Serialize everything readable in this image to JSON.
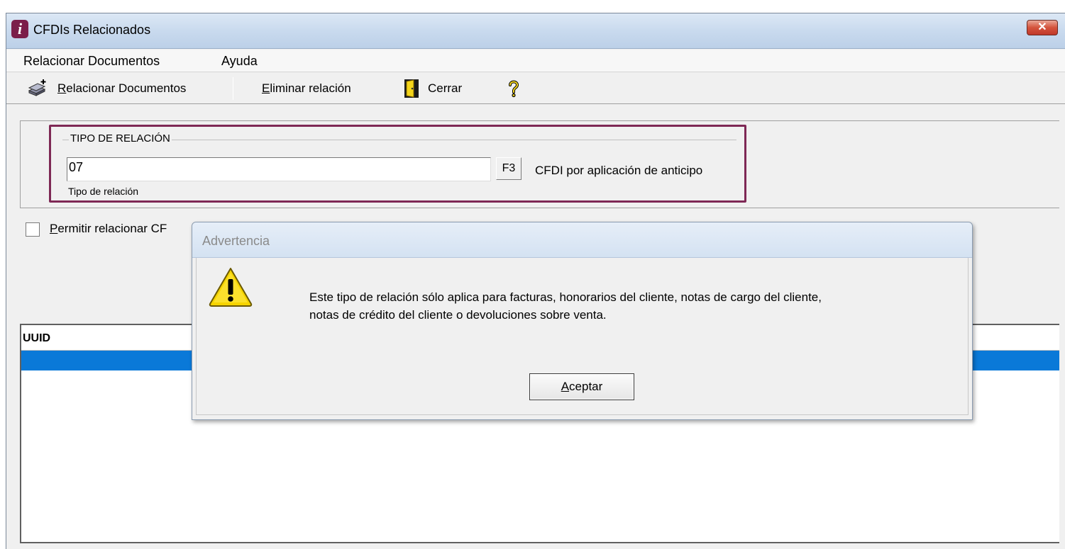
{
  "window": {
    "title": "CFDIs Relacionados",
    "icon_letter": "i",
    "close_glyph": "✕"
  },
  "menu": {
    "items": [
      "Relacionar Documentos",
      "Ayuda"
    ]
  },
  "toolbar": {
    "relacionar_first": "R",
    "relacionar_rest": "elacionar Documentos",
    "eliminar_first": "E",
    "eliminar_rest": "liminar relación",
    "cerrar_label": "Cerrar"
  },
  "relacion": {
    "legend": "TIPO DE RELACIÓN",
    "value": "07",
    "lookup_key": "F3",
    "description": "CFDI por aplicación de anticipo",
    "caption": "Tipo de relación"
  },
  "permitir": {
    "first": "P",
    "rest": "ermitir relacionar CF"
  },
  "grid": {
    "columns": [
      "UUID"
    ]
  },
  "dialog": {
    "title": "Advertencia",
    "message_line1": "Este tipo de relación sólo aplica para facturas, honorarios del cliente, notas de cargo del cliente,",
    "message_line2": "notas de crédito del cliente o devoluciones sobre venta.",
    "accept_first": "A",
    "accept_rest": "ceptar"
  },
  "colors": {
    "highlight_border": "#7e2855",
    "selection": "#0a79d8",
    "titlebar": "#c9daee"
  }
}
